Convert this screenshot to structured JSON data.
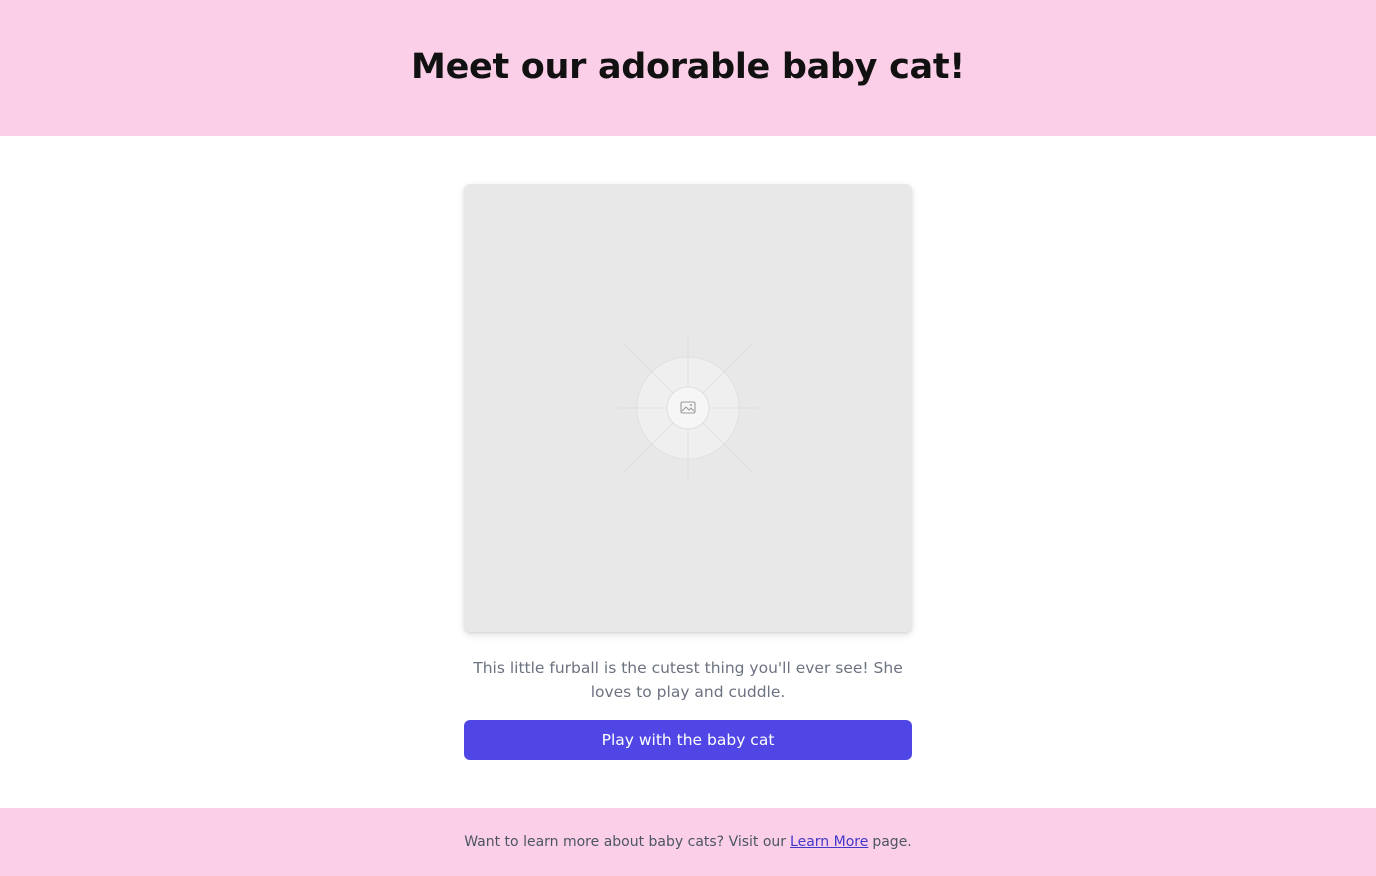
{
  "colors": {
    "header_bg": "#fbcfe8",
    "footer_bg": "#fbcfe8",
    "button_bg": "#4f46e5",
    "link": "#4338ca"
  },
  "header": {
    "title": "Meet our adorable baby cat!"
  },
  "main": {
    "image_icon": "image-placeholder-icon",
    "description": "This little furball is the cutest thing you'll ever see! She loves to play and cuddle.",
    "button_label": "Play with the baby cat"
  },
  "footer": {
    "text_before": "Want to learn more about baby cats? Visit our",
    "link_label": "Learn More",
    "text_after": "page."
  }
}
